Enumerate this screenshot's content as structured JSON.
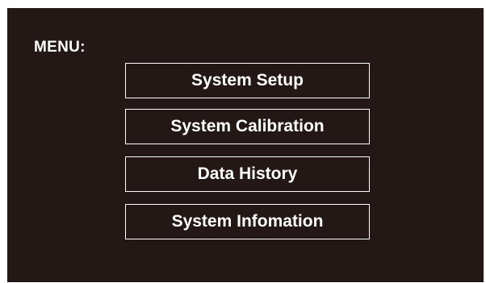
{
  "menu": {
    "title": "MENU:",
    "items": [
      {
        "label": "System Setup"
      },
      {
        "label": "System Calibration"
      },
      {
        "label": "Data History"
      },
      {
        "label": "System Infomation"
      }
    ]
  },
  "colors": {
    "background": "#231815",
    "foreground": "#ffffff"
  }
}
